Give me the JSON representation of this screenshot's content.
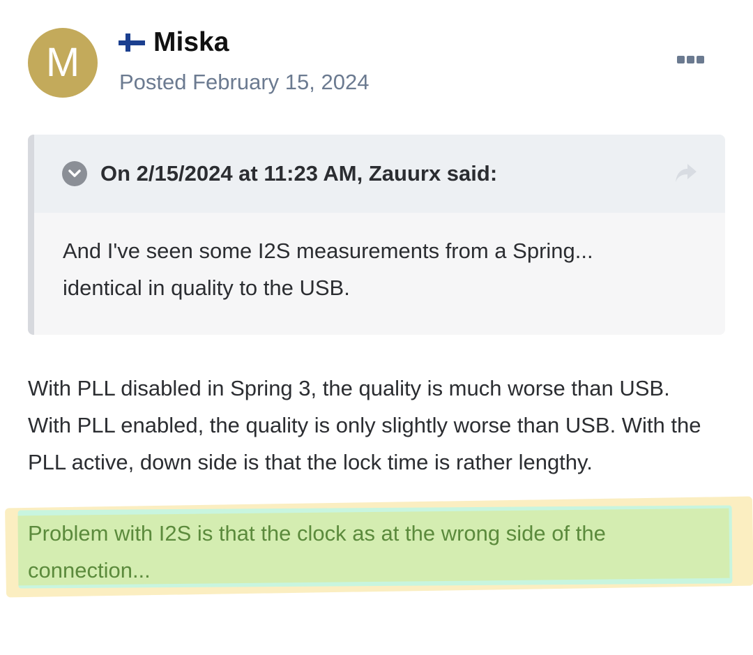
{
  "post": {
    "avatar_letter": "M",
    "author": "Miska",
    "flag_icon": "finland-flag-icon",
    "posted": "Posted February 15, 2024",
    "menu_icon": "more-options-icon"
  },
  "quote": {
    "citation": "On 2/15/2024 at 11:23 AM, Zauurx said:",
    "toggle_icon": "chevron-down-icon",
    "share_icon": "share-icon",
    "lines": [
      "And I've seen some I2S measurements from a Spring...",
      "identical in quality to the USB."
    ]
  },
  "body": {
    "lines": [
      "With PLL disabled in Spring 3, the quality is much worse than USB.",
      "With PLL enabled, the quality is only slightly worse than USB. With the",
      "PLL active, down side is that the lock time is rather lengthy."
    ],
    "highlight_lines": [
      "Problem with I2S is that the clock as at the wrong side of the",
      "connection..."
    ]
  },
  "colors": {
    "avatar": "#c3aa5b",
    "date": "#6b7a90",
    "highlight_text": "#5b8a3c",
    "highlight_fill": "#d4edb1"
  }
}
